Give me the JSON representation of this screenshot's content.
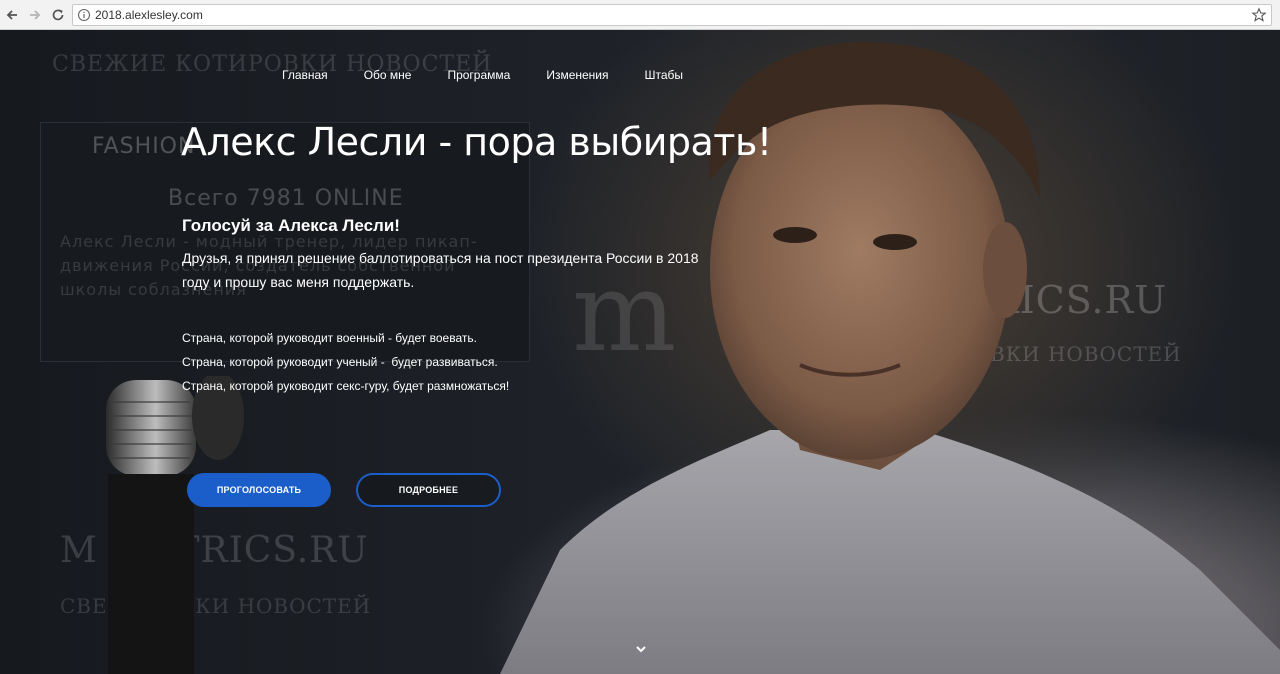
{
  "browser": {
    "url": "2018.alexlesley.com"
  },
  "background": {
    "watermarks": {
      "title": "СВЕЖИЕ КОТИРОВКИ НОВОСТЕЙ",
      "fashion": "FASHION",
      "online": "Всего 7981 ONLINE",
      "desc_line1": "Алекс Лесли - модный тренер, лидер пикап-",
      "desc_line2": "движения России, создатель собственной",
      "desc_line3": "школы соблазнения",
      "metrics1": "RICS.RU",
      "news1": "ВКИ НОВОСТЕЙ",
      "metrics2": "M     METRICS.RU",
      "news2": "СВЕ    ТИРОВКИ НОВОСТЕЙ",
      "m_letter": "m"
    }
  },
  "nav": {
    "items": [
      {
        "label": "Главная"
      },
      {
        "label": "Обо мне"
      },
      {
        "label": "Программа"
      },
      {
        "label": "Изменения"
      },
      {
        "label": "Штабы"
      }
    ]
  },
  "hero": {
    "title": "Алекс Лесли - пора выбирать!",
    "subtitle": "Голосуй за Алекса Лесли!",
    "lead": "Друзья, я принял решение баллотироваться на пост президента России в 2018 году и прошу вас меня поддержать.",
    "slogans": [
      "Страна, которой руководит военный - будет воевать.",
      "Страна, которой руководит ученый -  будет развиваться.",
      "Страна, которой руководит секс-гуру, будет размножаться!"
    ],
    "vote_button": "ПРОГОЛОСОВАТЬ",
    "more_button": "ПОДРОБНЕЕ"
  },
  "colors": {
    "accent": "#1b5ec9",
    "text": "#ffffff"
  },
  "icons": [
    "back-arrow-icon",
    "forward-arrow-icon",
    "reload-icon",
    "info-icon",
    "star-icon",
    "chevron-down-icon"
  ]
}
